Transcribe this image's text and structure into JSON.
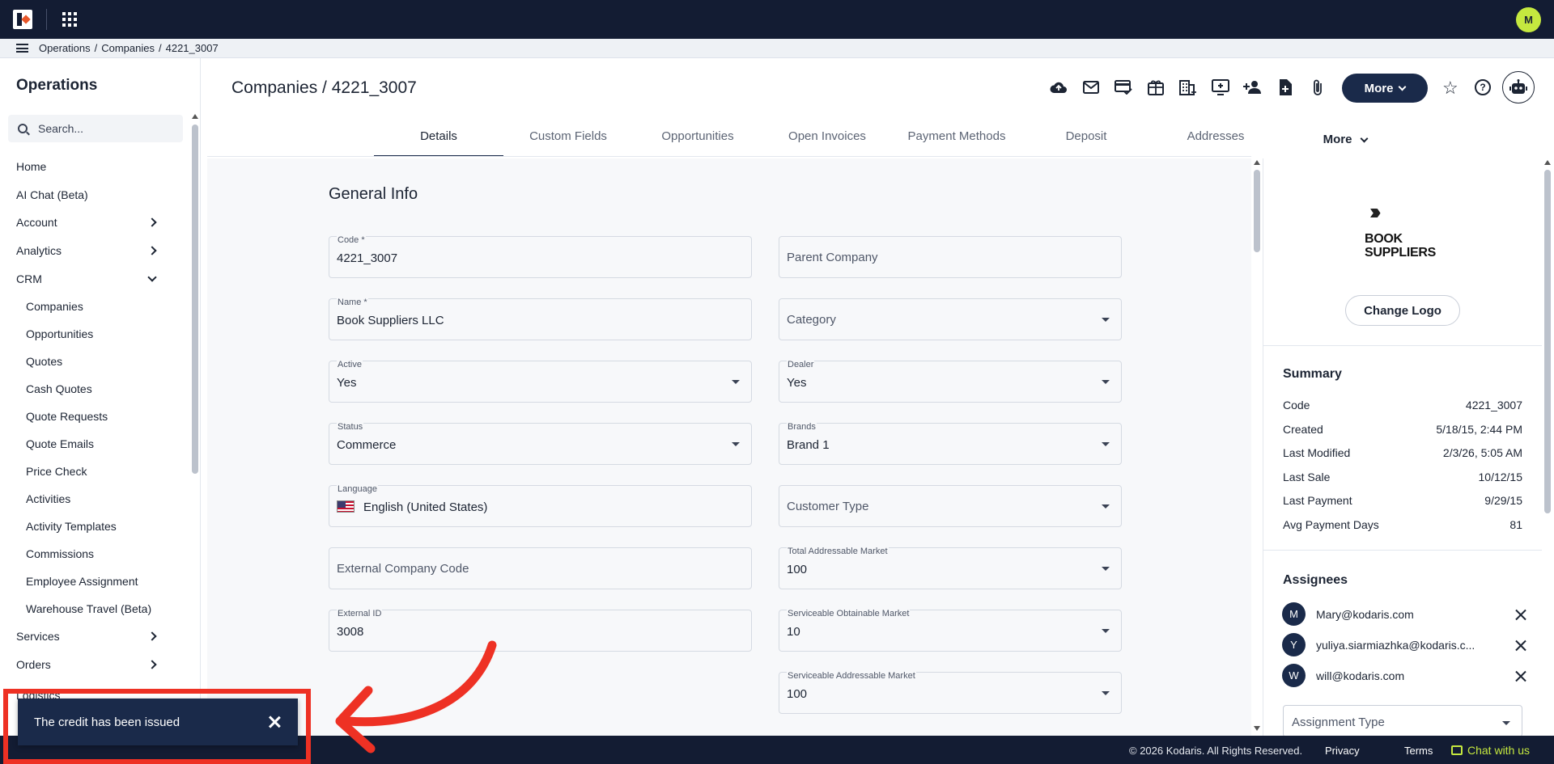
{
  "topbar": {
    "user_initial": "M"
  },
  "breadcrumb": {
    "items": [
      "Operations",
      "/",
      "Companies",
      "/",
      "4221_3007"
    ]
  },
  "sidebar": {
    "title": "Operations",
    "search_placeholder": "Search...",
    "items": [
      {
        "label": "Home",
        "expand": "none",
        "sub": false
      },
      {
        "label": "AI Chat (Beta)",
        "expand": "none",
        "sub": false
      },
      {
        "label": "Account",
        "expand": "right",
        "sub": false
      },
      {
        "label": "Analytics",
        "expand": "right",
        "sub": false
      },
      {
        "label": "CRM",
        "expand": "down",
        "sub": false
      },
      {
        "label": "Companies",
        "expand": "none",
        "sub": true
      },
      {
        "label": "Opportunities",
        "expand": "none",
        "sub": true
      },
      {
        "label": "Quotes",
        "expand": "none",
        "sub": true
      },
      {
        "label": "Cash Quotes",
        "expand": "none",
        "sub": true
      },
      {
        "label": "Quote Requests",
        "expand": "none",
        "sub": true
      },
      {
        "label": "Quote Emails",
        "expand": "none",
        "sub": true
      },
      {
        "label": "Price Check",
        "expand": "none",
        "sub": true
      },
      {
        "label": "Activities",
        "expand": "none",
        "sub": true
      },
      {
        "label": "Activity Templates",
        "expand": "none",
        "sub": true
      },
      {
        "label": "Commissions",
        "expand": "none",
        "sub": true
      },
      {
        "label": "Employee Assignment",
        "expand": "none",
        "sub": true
      },
      {
        "label": "Warehouse Travel (Beta)",
        "expand": "none",
        "sub": true
      },
      {
        "label": "Services",
        "expand": "right",
        "sub": false
      },
      {
        "label": "Orders",
        "expand": "right",
        "sub": false
      }
    ],
    "partial_item": "Logistics"
  },
  "header": {
    "title": "Companies / 4221_3007",
    "more_label": "More",
    "help_glyph": "?"
  },
  "tabs": [
    {
      "label": "Details",
      "active": true
    },
    {
      "label": "Custom Fields",
      "active": false
    },
    {
      "label": "Opportunities",
      "active": false
    },
    {
      "label": "Open Invoices",
      "active": false
    },
    {
      "label": "Payment Methods",
      "active": false
    },
    {
      "label": "Deposit",
      "active": false
    },
    {
      "label": "Addresses",
      "active": false
    }
  ],
  "tabs_more_label": "More",
  "form": {
    "section_title": "General Info",
    "code": {
      "label": "Code *",
      "value": "4221_3007"
    },
    "name": {
      "label": "Name *",
      "value": "Book Suppliers LLC"
    },
    "active": {
      "label": "Active",
      "value": "Yes"
    },
    "status": {
      "label": "Status",
      "value": "Commerce"
    },
    "language": {
      "label": "Language",
      "value": "English (United States)"
    },
    "external_company_code": {
      "placeholder": "External Company Code"
    },
    "external_id": {
      "label": "External ID",
      "value": "3008"
    },
    "parent_company": {
      "placeholder": "Parent Company"
    },
    "category": {
      "placeholder": "Category"
    },
    "dealer": {
      "label": "Dealer",
      "value": "Yes"
    },
    "brands": {
      "label": "Brands",
      "value": "Brand 1"
    },
    "customer_type": {
      "placeholder": "Customer Type"
    },
    "tam": {
      "label": "Total Addressable Market",
      "value": "100"
    },
    "som": {
      "label": "Serviceable Obtainable Market",
      "value": "10"
    },
    "sam": {
      "label": "Serviceable Addressable Market",
      "value": "100"
    }
  },
  "right_panel": {
    "logo_line1": "BOOK",
    "logo_line2": "SUPPLIERS",
    "change_logo_label": "Change Logo",
    "summary_title": "Summary",
    "summary": [
      {
        "label": "Code",
        "value": "4221_3007"
      },
      {
        "label": "Created",
        "value": "5/18/15, 2:44 PM"
      },
      {
        "label": "Last Modified",
        "value": "2/3/26, 5:05 AM"
      },
      {
        "label": "Last Sale",
        "value": "10/12/15"
      },
      {
        "label": "Last Payment",
        "value": "9/29/15"
      },
      {
        "label": "Avg Payment Days",
        "value": "81"
      }
    ],
    "assignees_title": "Assignees",
    "assignees": [
      {
        "initial": "M",
        "email": "Mary@kodaris.com"
      },
      {
        "initial": "Y",
        "email": "yuliya.siarmiazhka@kodaris.c..."
      },
      {
        "initial": "W",
        "email": "will@kodaris.com"
      }
    ],
    "assignment_type_placeholder": "Assignment Type"
  },
  "footer": {
    "copyright": "© 2026 Kodaris. All Rights Reserved.",
    "privacy": "Privacy",
    "terms": "Terms",
    "chat": "Chat with us"
  },
  "toast": {
    "message": "The credit has been issued"
  },
  "colors": {
    "nav_bg": "#131c33",
    "primary": "#1a2a4a",
    "accent": "#c5e83f",
    "annotation": "#ee3124"
  }
}
